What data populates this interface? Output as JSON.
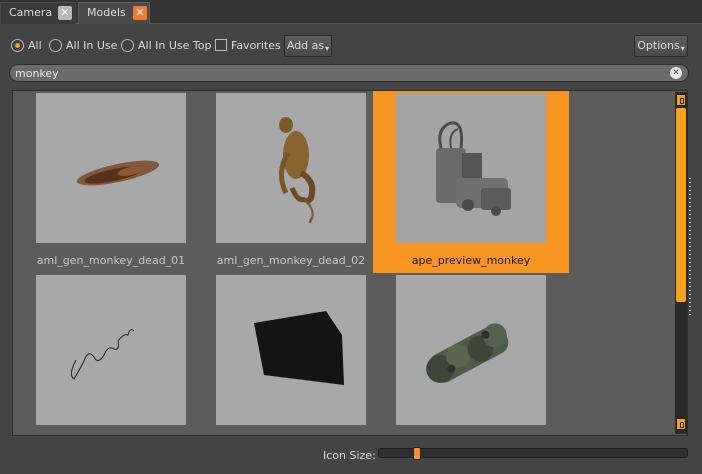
{
  "tabs": [
    {
      "label": "Camera",
      "active": false
    },
    {
      "label": "Models",
      "active": true
    }
  ],
  "filters": {
    "options": [
      "All",
      "All In Use",
      "All In Use Top"
    ],
    "selected": "All",
    "favorites_label": "Favorites",
    "favorites_checked": false,
    "add_as_label": "Add as",
    "options_label": "Options"
  },
  "search": {
    "value": "monkey"
  },
  "models": [
    {
      "name": "aml_gen_monkey_dead_01",
      "selected": false
    },
    {
      "name": "aml_gen_monkey_dead_02",
      "selected": false
    },
    {
      "name": "ape_preview_monkey",
      "selected": true
    },
    {
      "name": "",
      "selected": false
    },
    {
      "name": "",
      "selected": false
    },
    {
      "name": "",
      "selected": false
    }
  ],
  "icon_size": {
    "label": "Icon Size:",
    "value_fraction": 0.12
  },
  "colors": {
    "accent": "#f79522",
    "close_active": "#f37a2c"
  }
}
